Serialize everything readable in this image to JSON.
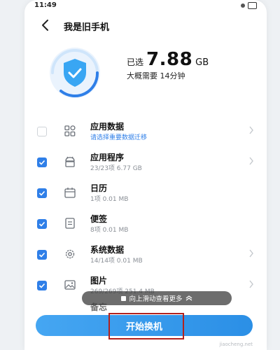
{
  "status": {
    "time": "11:49"
  },
  "header": {
    "title": "我是旧手机"
  },
  "summary": {
    "selected_label": "已选",
    "selected_value": "7.88",
    "selected_unit": "GB",
    "eta": "大概需要 14分钟"
  },
  "items": [
    {
      "title": "应用数据",
      "subtitle": "请选择重要数据迁移",
      "checked": false,
      "icon": "grid-icon"
    },
    {
      "title": "应用程序",
      "subtitle": "23/23项  6.77 GB",
      "checked": true,
      "icon": "android-icon"
    },
    {
      "title": "日历",
      "subtitle": "1项  0.01 MB",
      "checked": true,
      "icon": "calendar-icon"
    },
    {
      "title": "便签",
      "subtitle": "8项  0.01 MB",
      "checked": true,
      "icon": "note-icon"
    },
    {
      "title": "系统数据",
      "subtitle": "14/14项  0.01 MB",
      "checked": true,
      "icon": "gear-icon"
    },
    {
      "title": "图片",
      "subtitle": "269/269项  251.4 MB",
      "checked": true,
      "icon": "image-icon"
    }
  ],
  "hint": {
    "text": "向上滑动查看更多"
  },
  "next_item_partial": "备忘",
  "start_button": {
    "label": "开始换机"
  },
  "watermark": "jiaocheng.net",
  "colors": {
    "accent": "#2f7fe8",
    "highlight_box": "#b3211d"
  }
}
